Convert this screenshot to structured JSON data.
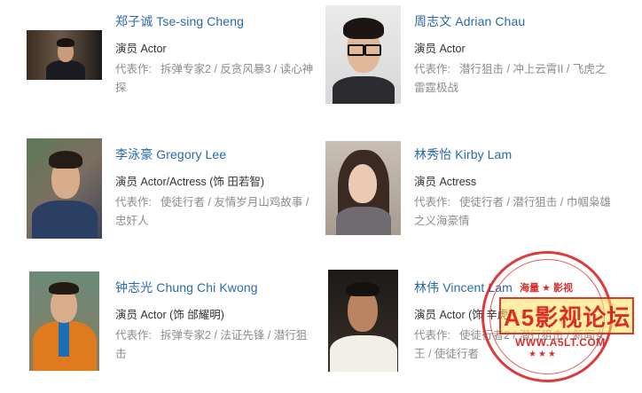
{
  "cast": [
    {
      "name": "郑子诚 Tse-sing Cheng",
      "role": "演员 Actor",
      "works_label": "代表作:",
      "works_line1": "拆弹专家2 / 反贪风暴3 / 读心神",
      "works_line2": "探"
    },
    {
      "name": "周志文 Adrian Chau",
      "role": "演员 Actor",
      "works_label": "代表作:",
      "works_line1": "潜行狙击 / 冲上云霄II / 飞虎之",
      "works_line2": "雷霆极战"
    },
    {
      "name": "李泳豪 Gregory Lee",
      "role": "演员 Actor/Actress (饰 田若智)",
      "works_label": "代表作:",
      "works_line1": "使徒行者 / 友情岁月山鸡故事 /",
      "works_line2": "忠奸人"
    },
    {
      "name": "林秀怡 Kirby Lam",
      "role": "演员 Actress",
      "works_label": "代表作:",
      "works_line1": "使徒行者 / 潜行狙击 / 巾帼枭雄",
      "works_line2": "之义海豪情"
    },
    {
      "name": "钟志光 Chung Chi Kwong",
      "role": "演员 Actor (饰 邰耀明)",
      "works_label": "代表作:",
      "works_line1": "拆弹专家2 / 法证先锋 / 潜行狙",
      "works_line2": "击"
    },
    {
      "name": "林伟 Vincent Lam",
      "role": "演员 Actor (饰 辛虎)",
      "works_label": "代表作:",
      "works_line1": "使徒行者2 / 潜行狙击 / 新闻女",
      "works_line2": "王 / 使徒行者"
    }
  ],
  "watermark": {
    "top_text": "海量 ★ 影视",
    "title": "A5影视论坛",
    "url": "WWW.A5LT.COM",
    "stars": "★★★"
  }
}
